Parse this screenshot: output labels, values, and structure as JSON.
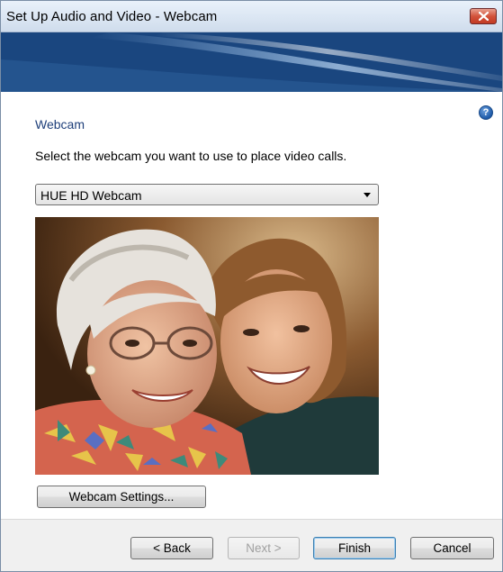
{
  "window": {
    "title": "Set Up Audio and Video - Webcam"
  },
  "main": {
    "heading": "Webcam",
    "instruction": "Select the webcam you want to use to place video calls.",
    "webcam_select": {
      "selected": "HUE HD Webcam"
    },
    "settings_button": "Webcam Settings..."
  },
  "footer": {
    "back": "< Back",
    "next": "Next >",
    "finish": "Finish",
    "cancel": "Cancel"
  },
  "icons": {
    "close": "close-icon",
    "help": "help-icon",
    "dropdown": "chevron-down-icon"
  },
  "colors": {
    "heading": "#1e3f7a",
    "banner": "#1e4f89",
    "close": "#c23a23"
  }
}
